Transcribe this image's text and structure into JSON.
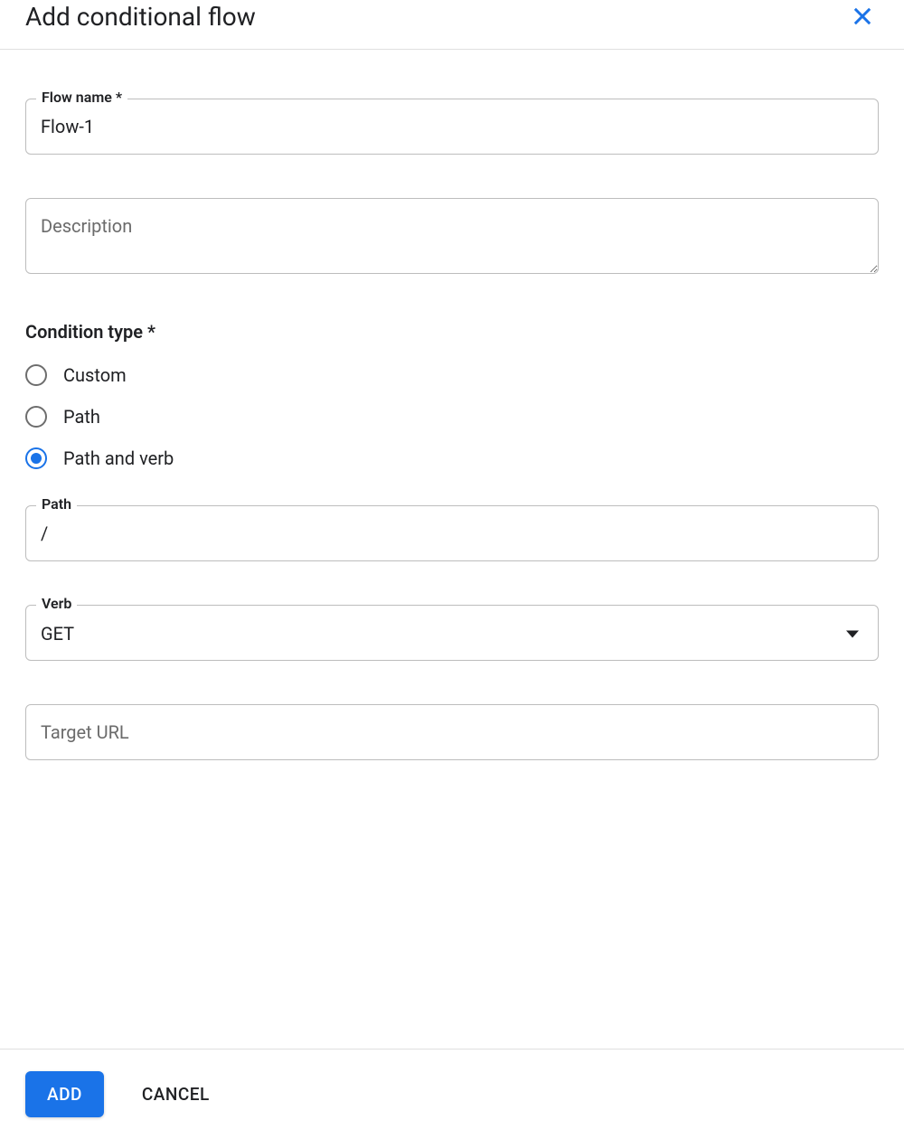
{
  "dialog": {
    "title": "Add conditional flow"
  },
  "fields": {
    "flow_name": {
      "label": "Flow name *",
      "value": "Flow-1"
    },
    "description": {
      "placeholder": "Description",
      "value": ""
    },
    "condition_type": {
      "label": "Condition type *",
      "options": {
        "custom": "Custom",
        "path": "Path",
        "path_and_verb": "Path and verb"
      },
      "selected": "path_and_verb"
    },
    "path": {
      "label": "Path",
      "value": "/"
    },
    "verb": {
      "label": "Verb",
      "value": "GET"
    },
    "target_url": {
      "placeholder": "Target URL",
      "value": ""
    }
  },
  "footer": {
    "add_label": "ADD",
    "cancel_label": "CANCEL"
  }
}
